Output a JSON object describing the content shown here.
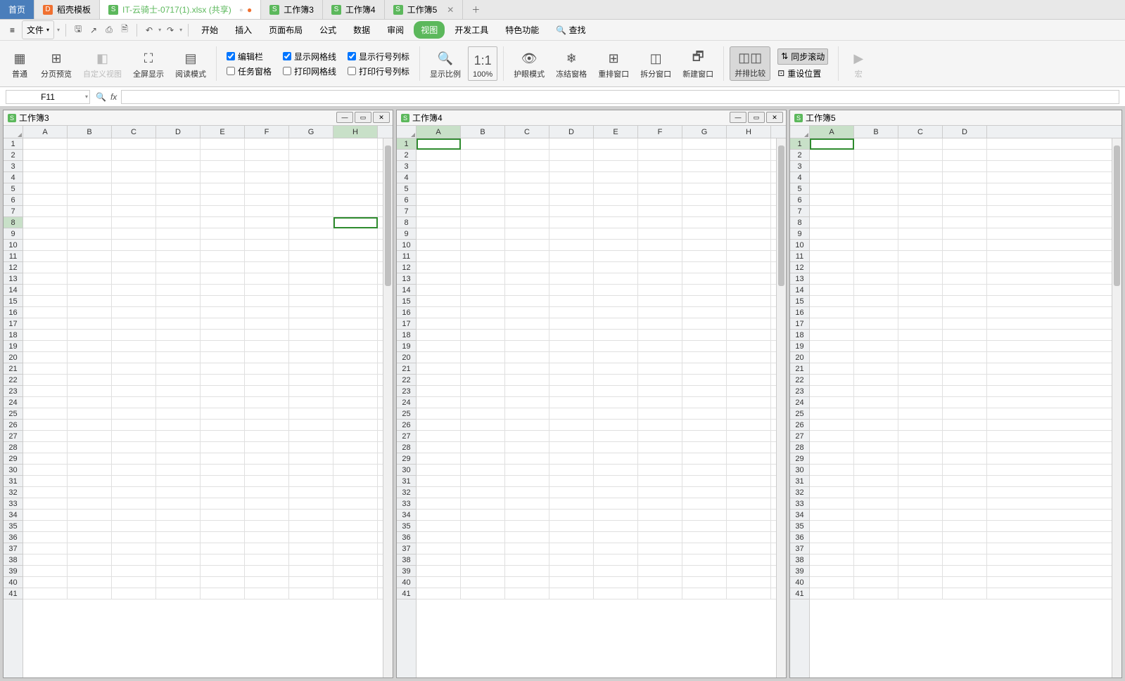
{
  "tabs": {
    "home": "首页",
    "template": "稻壳模板",
    "file1": "IT-云骑士-0717(1).xlsx (共享)",
    "wb3": "工作簿3",
    "wb4": "工作簿4",
    "wb5": "工作簿5"
  },
  "menu": {
    "file": "文件",
    "start": "开始",
    "insert": "插入",
    "page_layout": "页面布局",
    "formula": "公式",
    "data": "数据",
    "review": "审阅",
    "view": "视图",
    "dev_tools": "开发工具",
    "features": "特色功能",
    "find": "查找"
  },
  "ribbon": {
    "normal": "普通",
    "page_preview": "分页预览",
    "custom_view": "自定义视图",
    "fullscreen": "全屏显示",
    "read_mode": "阅读模式",
    "edit_bar": "编辑栏",
    "task_pane": "任务窗格",
    "show_grid": "显示网格线",
    "print_grid": "打印网格线",
    "show_rowcol": "显示行号列标",
    "print_rowcol": "打印行号列标",
    "zoom_ratio": "显示比例",
    "pct100": "100%",
    "eye_care": "护眼模式",
    "freeze": "冻结窗格",
    "arrange": "重排窗口",
    "split": "拆分窗口",
    "new_window": "新建窗口",
    "side_by_side": "并排比较",
    "sync_scroll": "同步滚动",
    "reset_pos": "重设位置",
    "macro": "宏"
  },
  "formula_bar": {
    "name": "F11",
    "fx": "fx"
  },
  "panes": {
    "p1": "工作簿3",
    "p2": "工作簿4",
    "p3": "工作簿5"
  },
  "columns": [
    "A",
    "B",
    "C",
    "D",
    "E",
    "F",
    "G",
    "H"
  ],
  "row_count": 41,
  "selections": {
    "pane1": {
      "row": 8,
      "col": "H"
    },
    "pane2": {
      "row": 1,
      "col": "A"
    },
    "pane3": {
      "row": 1,
      "col": "A"
    }
  }
}
